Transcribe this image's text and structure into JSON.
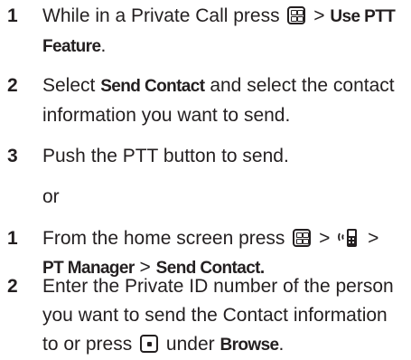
{
  "steps_a": [
    {
      "number": "1",
      "line1_pre": "While in a Private Call press",
      "line1_key": "menu-key-icon",
      "line1_gt": ">",
      "line1_kw": "Use PTT",
      "line2_kw": "Feature",
      "line2_post": "."
    },
    {
      "number": "2",
      "line1_pre": "Select",
      "line1_kw": "Send Contact",
      "line1_post": "and select the contact",
      "line2": "information you want to send."
    },
    {
      "number": "3",
      "line1": "Push the PTT button to send."
    }
  ],
  "or_text": "or",
  "steps_b": [
    {
      "number": "1",
      "line1_pre": "From the home screen press",
      "line1_key": "menu-key-icon",
      "line1_gt1": ">",
      "line1_icon": "ptt-phone-icon",
      "line1_gt2": ">",
      "line2_kw1": "PT Manager",
      "line2_gt": ">",
      "line2_kw2": "Send Contact."
    },
    {
      "number": "2",
      "line1": "Enter the Private ID number of the person",
      "line2": "you want to send the Contact information",
      "line3_pre": "to or press",
      "line3_key": "center-select-key-icon",
      "line3_mid": "under",
      "line3_kw": "Browse",
      "line3_post": "."
    }
  ]
}
